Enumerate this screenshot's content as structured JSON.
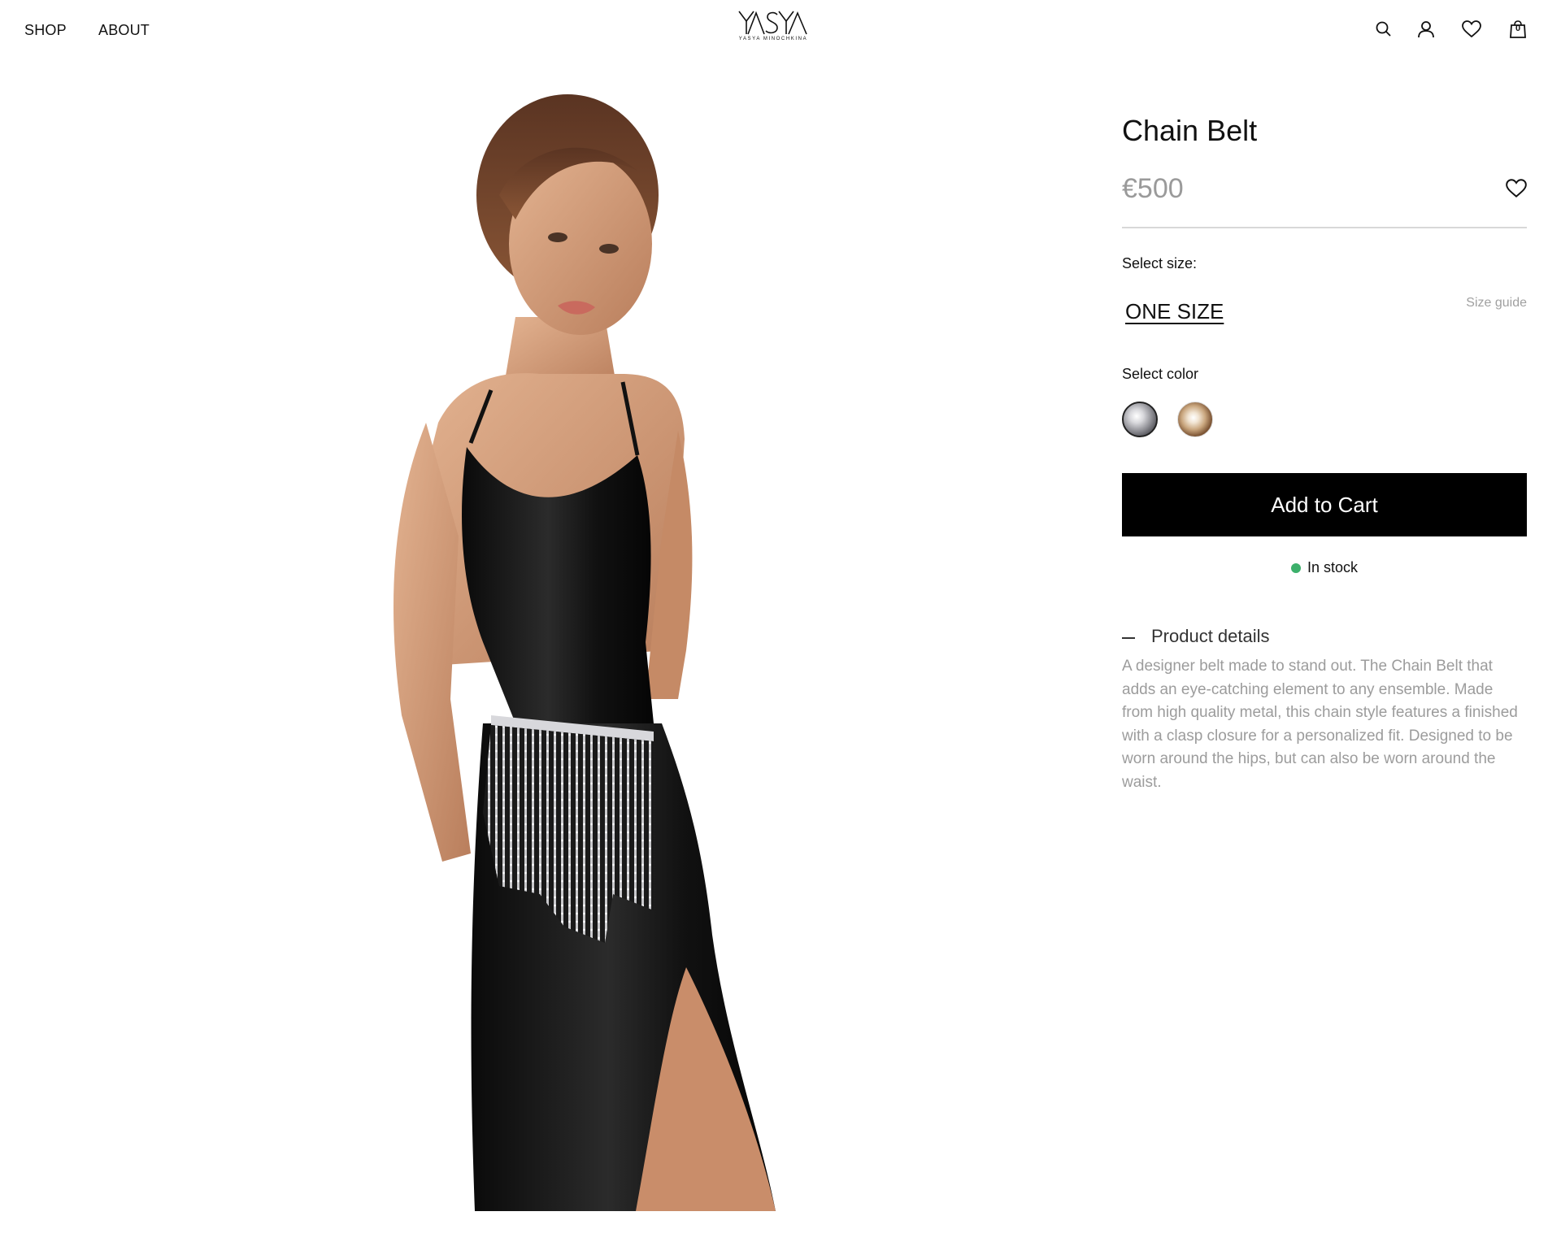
{
  "header": {
    "nav": [
      {
        "label": "SHOP"
      },
      {
        "label": "ABOUT"
      }
    ],
    "logo_text": "YASYA",
    "logo_subtext": "YASYA MINOCHKINA",
    "icons": [
      "search-icon",
      "account-icon",
      "wishlist-icon",
      "cart-icon"
    ],
    "cart_count": "0"
  },
  "product": {
    "title": "Chain Belt",
    "price": "€500",
    "select_size_label": "Select size:",
    "size_value": "ONE SIZE",
    "size_guide_label": "Size guide",
    "select_color_label": "Select color",
    "colors": [
      {
        "name": "silver",
        "hex": "#a8a8ae",
        "selected": true
      },
      {
        "name": "gold",
        "hex": "#c9a67e",
        "selected": false
      }
    ],
    "add_to_cart_label": "Add to Cart",
    "stock_status": "In stock",
    "stock_color": "#3cb06b",
    "details_title": "Product details",
    "details_text": "A designer belt made to stand out. The Chain Belt that adds an eye-catching element to any ensemble. Made from high quality metal, this chain style features a finished with a clasp closure for a personalized fit. Designed to be worn around the hips, but can also be worn around the waist."
  },
  "colors": {
    "primary_button": "#000000",
    "price_text": "#9a9a9a",
    "muted_text": "#9c9c9c"
  }
}
